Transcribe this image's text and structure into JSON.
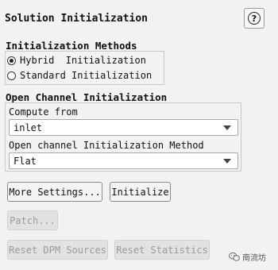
{
  "panel": {
    "title": "Solution Initialization",
    "help_label": "?"
  },
  "init_methods": {
    "label": "Initialization Methods",
    "options": [
      {
        "label": "Hybrid  Initialization",
        "selected": true
      },
      {
        "label": "Standard Initialization",
        "selected": false
      }
    ]
  },
  "open_channel": {
    "label": "Open Channel Initialization",
    "compute_from": {
      "label": "Compute from",
      "value": "inlet"
    },
    "method": {
      "label": "Open channel Initialization Method",
      "value": "Flat"
    }
  },
  "buttons": {
    "more_settings": "More Settings...",
    "initialize": "Initialize",
    "patch": "Patch...",
    "reset_dpm": "Reset DPM Sources",
    "reset_statistics": "Reset Statistics"
  },
  "watermark": {
    "text": "南流坊"
  },
  "icons": {
    "help": "help-icon",
    "dropdown": "chevron-down-icon",
    "watermark": "wechat-logo-icon"
  }
}
